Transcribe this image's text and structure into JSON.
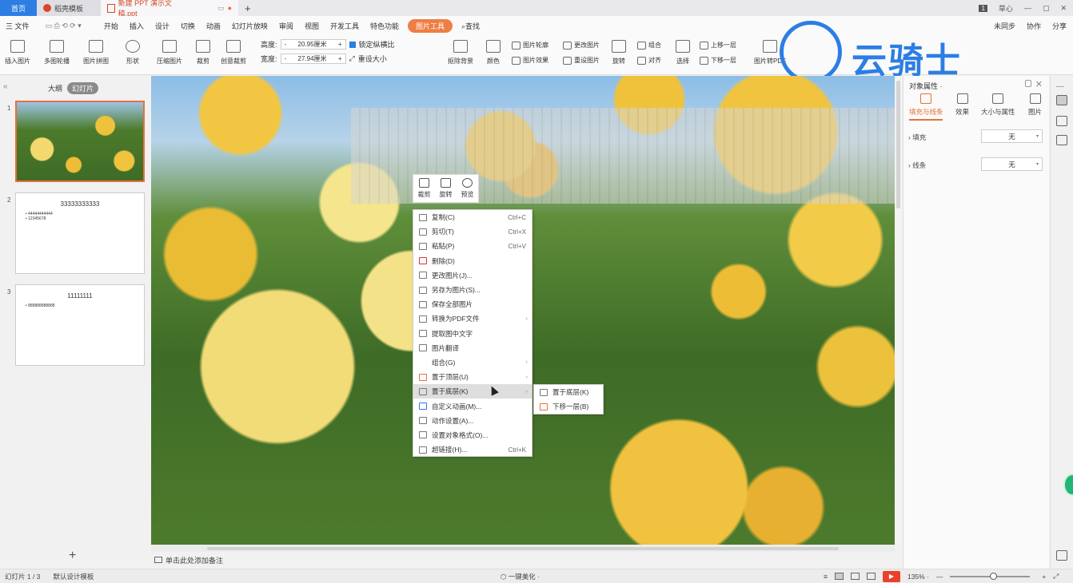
{
  "titlebar": {
    "home_tab": "首页",
    "tabs": [
      {
        "label": "稻壳模板"
      },
      {
        "label": "新建 PPT 演示文稿.ppt"
      }
    ],
    "new_tab": "+",
    "page_count_badge": "1",
    "user": "草心",
    "window_controls": [
      "—",
      "▢",
      "✕"
    ]
  },
  "menu": {
    "file": "三 文件",
    "items": [
      "开始",
      "插入",
      "设计",
      "切换",
      "动画",
      "幻灯片放映",
      "审阅",
      "视图",
      "开发工具",
      "特色功能"
    ],
    "active_tool": "图片工具",
    "search": "查找",
    "right": [
      "未同步",
      "协作",
      "分享"
    ]
  },
  "ribbon": {
    "insert_picture": "插入图片",
    "multi_outline": "多图轮播",
    "picture_collage": "图片拼图",
    "shape": "形状",
    "compress": "压缩图片",
    "crop": "裁剪",
    "creative_crop": "创意裁剪",
    "height_label": "高度:",
    "height_value": "20.95厘米",
    "width_label": "宽度:",
    "width_value": "27.94厘米",
    "lock_ratio": "锁定纵横比",
    "reset_size": "重设大小",
    "remove_bg": "抠除背景",
    "color": "颜色",
    "outline": "图片轮廓",
    "effect": "图片效果",
    "change_pic": "更改图片",
    "reset_pic": "重设图片",
    "rotate": "旋转",
    "group": "组合",
    "align": "对齐",
    "select": "选择",
    "bring_forward": "上移一层",
    "send_backward": "下移一层",
    "to_pdf": "图片转PDF"
  },
  "watermark": {
    "text": "云骑士"
  },
  "left_panel": {
    "tab_outline": "大纲",
    "tab_slides": "幻灯片",
    "slides": [
      {
        "num": "1"
      },
      {
        "num": "2",
        "title": "33333333333",
        "bullets": [
          "44444444444",
          "12345678"
        ]
      },
      {
        "num": "3",
        "title": "11111111",
        "bullets": [
          "888888888888"
        ]
      }
    ],
    "add": "+"
  },
  "mini_toolbar": {
    "crop": "裁剪",
    "rotate": "旋转",
    "preview": "预览"
  },
  "context_menu": {
    "items": [
      {
        "label": "复制(C)",
        "shortcut": "Ctrl+C"
      },
      {
        "label": "剪切(T)",
        "shortcut": "Ctrl+X"
      },
      {
        "label": "粘贴(P)",
        "shortcut": "Ctrl+V"
      },
      {
        "label": "删除(D)",
        "shortcut": ""
      },
      {
        "label": "更改图片(J)...",
        "shortcut": ""
      },
      {
        "label": "另存为图片(S)...",
        "shortcut": ""
      },
      {
        "label": "保存全部图片",
        "shortcut": ""
      },
      {
        "label": "转换为PDF文件",
        "shortcut": ""
      },
      {
        "label": "提取图中文字",
        "shortcut": ""
      },
      {
        "label": "图片翻译",
        "shortcut": ""
      },
      {
        "label": "组合(G)",
        "shortcut": ""
      },
      {
        "label": "置于顶层(U)",
        "shortcut": ""
      },
      {
        "label": "置于底层(K)",
        "shortcut": ""
      },
      {
        "label": "自定义动画(M)...",
        "shortcut": ""
      },
      {
        "label": "动作设置(A)...",
        "shortcut": ""
      },
      {
        "label": "设置对象格式(O)...",
        "shortcut": ""
      },
      {
        "label": "超链接(H)...",
        "shortcut": "Ctrl+K"
      }
    ],
    "submenu": [
      {
        "label": "置于底层(K)"
      },
      {
        "label": "下移一层(B)"
      }
    ]
  },
  "notes": {
    "placeholder": "单击此处添加备注"
  },
  "right_panel": {
    "title": "对象属性 ·",
    "tabs": [
      "填充与线条",
      "效果",
      "大小与属性",
      "图片"
    ],
    "fill_label": "填充",
    "fill_value": "无",
    "line_label": "线条",
    "line_value": "无"
  },
  "statusbar": {
    "slide_info": "幻灯片 1 / 3",
    "template": "默认设计模板",
    "beautify": "一键美化 ·",
    "zoom": "135% ·",
    "minus": "—",
    "plus": "+"
  }
}
